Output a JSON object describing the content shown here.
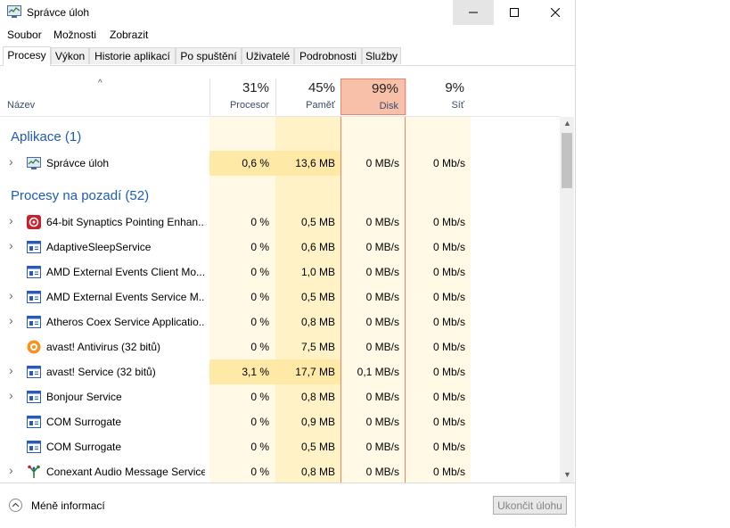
{
  "window": {
    "title": "Správce úloh"
  },
  "menu": [
    "Soubor",
    "Možnosti",
    "Zobrazit"
  ],
  "tabs": [
    "Procesy",
    "Výkon",
    "Historie aplikací",
    "Po spuštění",
    "Uživatelé",
    "Podrobnosti",
    "Služby"
  ],
  "active_tab": "Procesy",
  "header": {
    "name_label": "Název",
    "sort_arrow": "^",
    "columns": [
      {
        "pct": "31%",
        "label": "Procesor"
      },
      {
        "pct": "45%",
        "label": "Paměť"
      },
      {
        "pct": "99%",
        "label": "Disk"
      },
      {
        "pct": "9%",
        "label": "Síť"
      }
    ]
  },
  "groups": {
    "apps": "Aplikace (1)",
    "background": "Procesy na pozadí (52)"
  },
  "apps": [
    {
      "name": "Správce úloh",
      "cpu": "0,6 %",
      "mem": "13,6 MB",
      "disk": "0 MB/s",
      "net": "0 Mb/s",
      "icon": "task-manager-icon",
      "expand": true
    }
  ],
  "processes": [
    {
      "name": "64-bit Synaptics Pointing Enhan...",
      "cpu": "0 %",
      "mem": "0,5 MB",
      "disk": "0 MB/s",
      "net": "0 Mb/s",
      "icon": "synaptics-icon",
      "expand": true
    },
    {
      "name": "AdaptiveSleepService",
      "cpu": "0 %",
      "mem": "0,6 MB",
      "disk": "0 MB/s",
      "net": "0 Mb/s",
      "icon": "service-icon",
      "expand": true
    },
    {
      "name": "AMD External Events Client Mo...",
      "cpu": "0 %",
      "mem": "1,0 MB",
      "disk": "0 MB/s",
      "net": "0 Mb/s",
      "icon": "service-icon",
      "expand": false
    },
    {
      "name": "AMD External Events Service M...",
      "cpu": "0 %",
      "mem": "0,5 MB",
      "disk": "0 MB/s",
      "net": "0 Mb/s",
      "icon": "service-icon",
      "expand": true
    },
    {
      "name": "Atheros Coex Service Applicatio...",
      "cpu": "0 %",
      "mem": "0,8 MB",
      "disk": "0 MB/s",
      "net": "0 Mb/s",
      "icon": "service-icon",
      "expand": true
    },
    {
      "name": "avast! Antivirus (32 bitů)",
      "cpu": "0 %",
      "mem": "7,5 MB",
      "disk": "0 MB/s",
      "net": "0 Mb/s",
      "icon": "avast-icon",
      "expand": false
    },
    {
      "name": "avast! Service (32 bitů)",
      "cpu": "3,1 %",
      "mem": "17,7 MB",
      "disk": "0,1 MB/s",
      "net": "0 Mb/s",
      "icon": "service-icon",
      "expand": true
    },
    {
      "name": "Bonjour Service",
      "cpu": "0 %",
      "mem": "0,8 MB",
      "disk": "0 MB/s",
      "net": "0 Mb/s",
      "icon": "service-icon",
      "expand": true
    },
    {
      "name": "COM Surrogate",
      "cpu": "0 %",
      "mem": "0,9 MB",
      "disk": "0 MB/s",
      "net": "0 Mb/s",
      "icon": "service-icon",
      "expand": false
    },
    {
      "name": "COM Surrogate",
      "cpu": "0 %",
      "mem": "0,5 MB",
      "disk": "0 MB/s",
      "net": "0 Mb/s",
      "icon": "service-icon",
      "expand": false
    },
    {
      "name": "Conexant Audio Message Service",
      "cpu": "0 %",
      "mem": "0,8 MB",
      "disk": "0 MB/s",
      "net": "0 Mb/s",
      "icon": "conexant-icon",
      "expand": true
    }
  ],
  "footer": {
    "fewer_details": "Méně informací",
    "end_task": "Ukončit úlohu"
  },
  "colors": {
    "col_light": "#fff9e6",
    "col_mid": "#fff2c6",
    "col_strong": "#ffe9a7",
    "disk_header": "#f8c0a8",
    "disk_border": "#e8866a",
    "group_text": "#1e5bb8"
  }
}
